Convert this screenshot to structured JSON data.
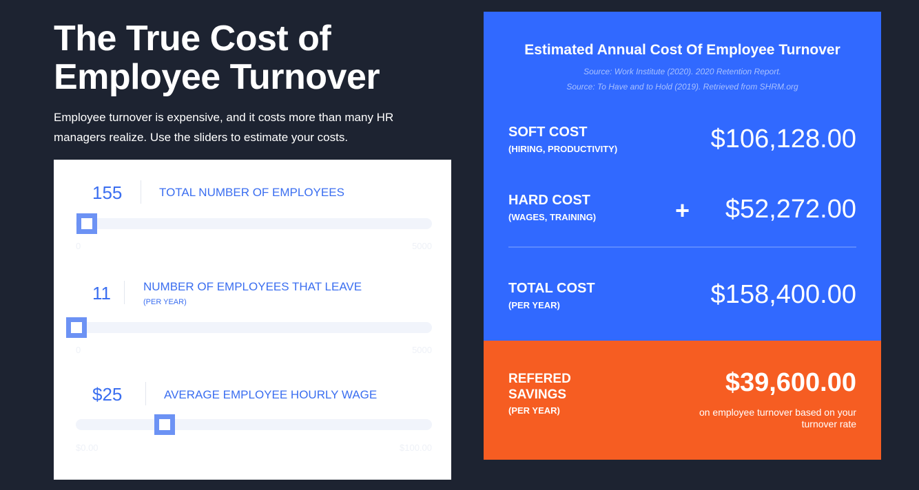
{
  "hero": {
    "title_line1": "The True Cost of",
    "title_line2": "Employee Turnover",
    "subtitle": "Employee turnover is expensive, and it costs more than many HR managers realize. Use the sliders to estimate your costs."
  },
  "sliders": [
    {
      "value": "155",
      "label": "TOTAL NUMBER OF EMPLOYEES",
      "sublabel": "",
      "min_label": "0",
      "max_label": "5000",
      "level_fraction": 0.031
    },
    {
      "value": "11",
      "label": "NUMBER OF EMPLOYEES THAT LEAVE",
      "sublabel": "(PER YEAR)",
      "min_label": "0",
      "max_label": "5000",
      "level_fraction": 0.002
    },
    {
      "value": "$25",
      "label": "AVERAGE EMPLOYEE HOURLY WAGE",
      "sublabel": "",
      "min_label": "$0.00",
      "max_label": "$100.00",
      "level_fraction": 0.25
    }
  ],
  "panel": {
    "title": "Estimated Annual Cost Of Employee Turnover",
    "source1": "Source: Work Institute (2020). 2020 Retention Report.",
    "source2": "Source: To Have and to Hold (2019). Retrieved from SHRM.org",
    "soft_label": "SOFT COST",
    "soft_sub": "(HIRING, PRODUCTIVITY)",
    "soft_amount": "$106,128.00",
    "hard_label": "HARD COST",
    "hard_sub": "(WAGES, TRAINING)",
    "plus": "+",
    "hard_amount": "$52,272.00",
    "total_label": "TOTAL COST",
    "total_sub": "(PER YEAR)",
    "total_amount": "$158,400.00"
  },
  "savings": {
    "label": "REFERED SAVINGS",
    "sub": "(PER YEAR)",
    "amount": "$39,600.00",
    "note": "on employee turnover based on your turnover rate"
  },
  "colors": {
    "background": "#1d2331",
    "accent_blue": "#3169ff",
    "savings_orange": "#f65d22",
    "slider_thumb": "#6c92f4"
  }
}
